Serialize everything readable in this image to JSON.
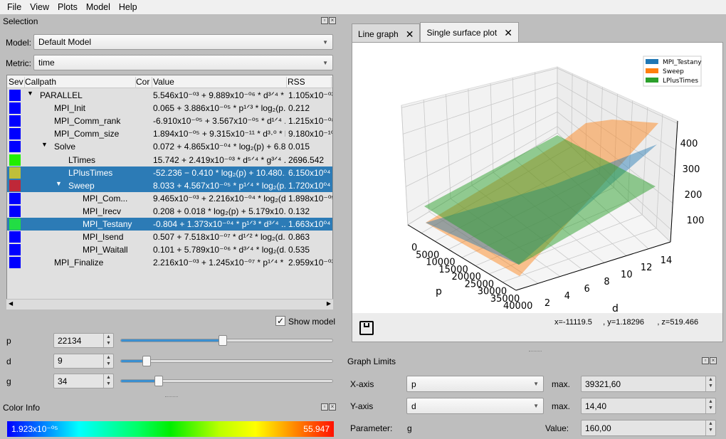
{
  "menu": [
    "File",
    "View",
    "Plots",
    "Model",
    "Help"
  ],
  "selection": {
    "title": "Selection",
    "model_label": "Model:",
    "model_value": "Default Model",
    "metric_label": "Metric:",
    "metric_value": "time",
    "columns": [
      "Sev",
      "Callpath",
      "Cor",
      "Value",
      "RSS"
    ],
    "rows": [
      {
        "name": "PARALLEL",
        "level": 0,
        "expanded": true,
        "color": "#0000ff",
        "value": "5.546x10⁻⁰³ + 9.889x10⁻⁰⁶ * d³ᐟ⁴ * ...",
        "rss": "1.105x10⁻⁰³",
        "selected": false
      },
      {
        "name": "MPI_Init",
        "level": 1,
        "color": "#0000ff",
        "value": "0.065 + 3.886x10⁻⁰⁵ * p¹ᐟ³ * log₂(p...",
        "rss": "0.212",
        "selected": false
      },
      {
        "name": "MPI_Comm_rank",
        "level": 1,
        "color": "#0000ff",
        "value": "-6.910x10⁻⁰⁵ + 3.567x10⁻⁰⁵ * d¹ᐟ⁴ ...",
        "rss": "1.215x10⁻⁰⁸",
        "selected": false
      },
      {
        "name": "MPI_Comm_size",
        "level": 1,
        "color": "#0000ff",
        "value": "1.894x10⁻⁰⁵ + 9.315x10⁻¹¹ * d³·⁰ * l...",
        "rss": "9.180x10⁻¹⁰",
        "selected": false
      },
      {
        "name": "Solve",
        "level": 1,
        "expanded": true,
        "color": "#0000ff",
        "value": "0.072 + 4.865x10⁻⁰⁴ * log₂(p) + 6.8...",
        "rss": "0.015",
        "selected": false
      },
      {
        "name": "LTimes",
        "level": 2,
        "color": "#22ee00",
        "value": "15.742 + 2.419x10⁻⁰³ * d⁵ᐟ⁴ * g³ᐟ⁴ ...",
        "rss": "2696.542",
        "selected": false
      },
      {
        "name": "LPlusTimes",
        "level": 2,
        "color": "#bfbf3a",
        "value": "-52.236 − 0.410 * log₂(p) + 10.480...",
        "rss": "6.150x10⁰⁴",
        "selected": true
      },
      {
        "name": "Sweep",
        "level": 2,
        "expanded": true,
        "color": "#bf2838",
        "value": "8.033 + 4.567x10⁻⁰⁵ * p¹ᐟ⁴ * log₂(p...",
        "rss": "1.720x10⁰⁴",
        "selected": true
      },
      {
        "name": "MPI_Com...",
        "level": 3,
        "color": "#0000ff",
        "value": "9.465x10⁻⁰³ + 2.216x10⁻⁰⁴ * log₂(d...",
        "rss": "1.898x10⁻⁰⁵",
        "selected": false
      },
      {
        "name": "MPI_Irecv",
        "level": 3,
        "color": "#0000ff",
        "value": "0.208 + 0.018 * log₂(p) + 5.179x10...",
        "rss": "0.132",
        "selected": false
      },
      {
        "name": "MPI_Testany",
        "level": 3,
        "color": "#22dd44",
        "value": "-0.804 + 1.373x10⁻⁰⁴ * p¹ᐟ³ * d³ᐟ⁴ ...",
        "rss": "1.663x10⁰⁴",
        "selected": true
      },
      {
        "name": "MPI_Isend",
        "level": 3,
        "color": "#0000ff",
        "value": "0.507 + 7.518x10⁻⁰⁷ * d¹ᐟ² * log₂(d...",
        "rss": "0.863",
        "selected": false
      },
      {
        "name": "MPI_Waitall",
        "level": 3,
        "color": "#0000ff",
        "value": "0.101 + 5.789x10⁻⁰⁶ * d³ᐟ⁴ * log₂(d...",
        "rss": "0.535",
        "selected": false
      },
      {
        "name": "MPI_Finalize",
        "level": 1,
        "color": "#0000ff",
        "value": "2.216x10⁻⁰³ + 1.245x10⁻⁰⁷ * p¹ᐟ⁴ * ...",
        "rss": "2.959x10⁻⁰³",
        "selected": false
      }
    ],
    "show_model_label": "Show model",
    "show_model_checked": true,
    "params": [
      {
        "name": "p",
        "value": "22134",
        "slider_percent": 48
      },
      {
        "name": "d",
        "value": "9",
        "slider_percent": 12
      },
      {
        "name": "g",
        "value": "34",
        "slider_percent": 18
      }
    ]
  },
  "color_info": {
    "title": "Color Info",
    "min": "1.923x10⁻⁰⁵",
    "max": "55.947"
  },
  "tabs": [
    {
      "label": "Line graph",
      "active": false
    },
    {
      "label": "Single surface plot",
      "active": true
    }
  ],
  "plot": {
    "legend": [
      {
        "name": "MPI_Testany",
        "color": "#1f77b4"
      },
      {
        "name": "Sweep",
        "color": "#ff7f0e"
      },
      {
        "name": "LPlusTimes",
        "color": "#2ca02c"
      }
    ],
    "x_label": "p",
    "y_label": "d",
    "x_ticks": [
      "0",
      "5000",
      "10000",
      "15000",
      "20000",
      "25000",
      "30000",
      "35000",
      "40000"
    ],
    "y_ticks": [
      "2",
      "4",
      "6",
      "8",
      "10",
      "12",
      "14"
    ],
    "z_ticks": [
      "100",
      "200",
      "300",
      "400"
    ],
    "coords": "x=-11119.5     , y=1.18296      , z=519.466"
  },
  "graph_limits": {
    "title": "Graph Limits",
    "x_axis_label": "X-axis",
    "x_axis_value": "p",
    "x_max_label": "max.",
    "x_max": "39321,60",
    "y_axis_label": "Y-axis",
    "y_axis_value": "d",
    "y_max_label": "max.",
    "y_max": "14,40",
    "param_label": "Parameter:",
    "param_value": "g",
    "value_label": "Value:",
    "value": "160,00"
  }
}
